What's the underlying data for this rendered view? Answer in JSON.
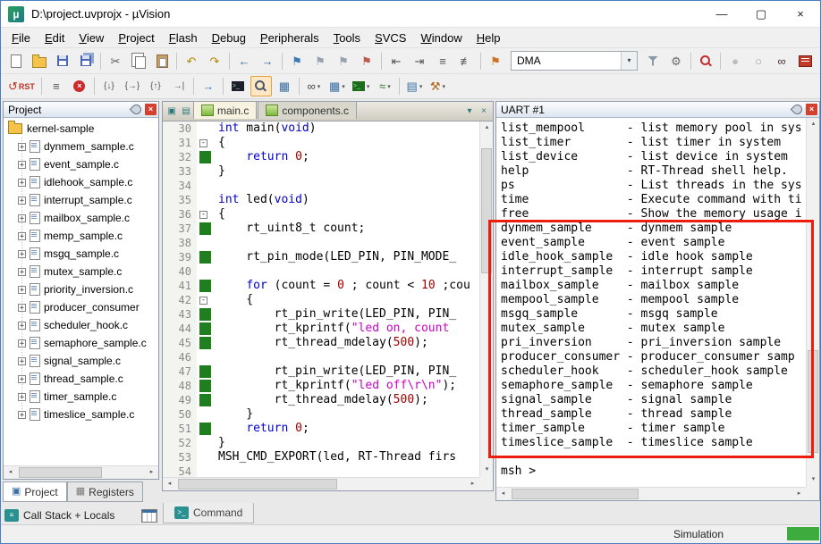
{
  "window": {
    "title": "D:\\project.uvprojx - µVision",
    "minimize_glyph": "—",
    "maximize_glyph": "▢",
    "close_glyph": "×"
  },
  "menu": {
    "items": [
      "File",
      "Edit",
      "View",
      "Project",
      "Flash",
      "Debug",
      "Peripherals",
      "Tools",
      "SVCS",
      "Window",
      "Help"
    ]
  },
  "toolbar1": {
    "target": "DMA",
    "left": [
      {
        "name": "new-file-icon",
        "cls": "ic-page"
      },
      {
        "name": "open-file-icon",
        "cls": "ic-folder"
      },
      {
        "name": "save-icon",
        "cls": "ic-floppy"
      },
      {
        "name": "save-all-icon",
        "cls": "ic-floppy saveall"
      },
      {
        "sep": true
      },
      {
        "name": "cut-icon",
        "glyph": "✂",
        "color": "#5a5a5a"
      },
      {
        "name": "copy-icon",
        "cls": "ic-copy"
      },
      {
        "name": "paste-icon",
        "cls": "ic-paste"
      },
      {
        "sep": true
      },
      {
        "name": "undo-icon",
        "glyph": "↶",
        "color": "#b08900"
      },
      {
        "name": "redo-icon",
        "glyph": "↷",
        "color": "#b08900"
      },
      {
        "sep": true
      },
      {
        "name": "navigate-back-icon",
        "glyph": "←",
        "color": "#2f66a0"
      },
      {
        "name": "navigate-forward-icon",
        "glyph": "→",
        "color": "#2f66a0"
      },
      {
        "sep": true
      },
      {
        "name": "toggle-bookmark-icon",
        "glyph": "⚑",
        "color": "#3b79b8"
      },
      {
        "name": "prev-bookmark-icon",
        "glyph": "⚑",
        "color": "#98a2ac"
      },
      {
        "name": "next-bookmark-icon",
        "glyph": "⚑",
        "color": "#98a2ac"
      },
      {
        "name": "clear-bookmarks-icon",
        "glyph": "⚑",
        "color": "#bf5a4a"
      },
      {
        "sep": true
      },
      {
        "name": "unindent-icon",
        "glyph": "⇤",
        "color": "#555555"
      },
      {
        "name": "indent-icon",
        "glyph": "⇥",
        "color": "#555555"
      },
      {
        "name": "comment-icon",
        "glyph": "≡",
        "color": "#555555"
      },
      {
        "name": "uncomment-icon",
        "glyph": "≢",
        "color": "#555555"
      },
      {
        "sep": true
      },
      {
        "name": "debug-target-icon",
        "glyph": "⚑",
        "color": "#d07020"
      }
    ],
    "right": [
      {
        "name": "options-for-target-icon",
        "cls": "ic-funnel"
      },
      {
        "name": "configure-flash-icon",
        "glyph": "⚙",
        "color": "#6a6a6a"
      },
      {
        "sep": true
      },
      {
        "name": "find-in-files-icon",
        "cls": "ic-magred"
      },
      {
        "sep": true
      },
      {
        "name": "start-stop-debug-icon",
        "glyph": "●",
        "color": "#bcbcbc"
      },
      {
        "name": "breakpoint-circle-icon",
        "glyph": "○",
        "color": "#9a9a9a"
      },
      {
        "name": "debug-views-icon",
        "glyph": "∞",
        "color": "#4a3030"
      },
      {
        "name": "books-icon",
        "cls": "ic-book"
      }
    ]
  },
  "toolbar2": {
    "items": [
      {
        "name": "reset-icon",
        "glyph": "↺",
        "color": "#c03020",
        "text": "RST"
      },
      {
        "sep": true
      },
      {
        "name": "breakpoint-list-icon",
        "glyph": "≡",
        "color": "#555555"
      },
      {
        "name": "kill-breakpoints-icon",
        "cls": "ic-stop"
      },
      {
        "sep": true
      },
      {
        "name": "step-into-icon",
        "glyph": "{↓}",
        "small": true,
        "color": "#555555"
      },
      {
        "name": "step-over-icon",
        "glyph": "{→}",
        "small": true,
        "color": "#555555"
      },
      {
        "name": "step-out-icon",
        "glyph": "{↑}",
        "small": true,
        "color": "#555555"
      },
      {
        "name": "run-to-cursor-icon",
        "glyph": "→|",
        "small": true,
        "color": "#555555"
      },
      {
        "sep": true
      },
      {
        "name": "go-icon",
        "glyph": "→",
        "color": "#3a7abf"
      },
      {
        "sep": true
      },
      {
        "name": "command-window-icon",
        "cls": "ic-console"
      },
      {
        "name": "serial-window-icon",
        "cls": "ic-mag",
        "active": true
      },
      {
        "name": "symbol-window-icon",
        "glyph": "▦",
        "color": "#3a6ea5"
      },
      {
        "sep": true
      },
      {
        "name": "watch-windows-icon",
        "glyph": "∞",
        "color": "#444444",
        "drop": true
      },
      {
        "name": "memory-windows-icon",
        "glyph": "▦",
        "color": "#3a6ea5",
        "drop": true
      },
      {
        "name": "serial-windows-icon",
        "cls": "ic-console green",
        "drop": true
      },
      {
        "name": "analysis-windows-icon",
        "glyph": "≈",
        "color": "#2a7a2a",
        "drop": true
      },
      {
        "sep": true
      },
      {
        "name": "system-viewer-icon",
        "glyph": "▤",
        "color": "#3a6ea5",
        "drop": true
      },
      {
        "name": "toolbox-icon",
        "glyph": "⚒",
        "color": "#b06820",
        "drop": true
      }
    ]
  },
  "project_panel": {
    "title": "Project",
    "root": "kernel-sample",
    "files": [
      "dynmem_sample.c",
      "event_sample.c",
      "idlehook_sample.c",
      "interrupt_sample.c",
      "mailbox_sample.c",
      "memp_sample.c",
      "msgq_sample.c",
      "mutex_sample.c",
      "priority_inversion.c",
      "producer_consumer",
      "scheduler_hook.c",
      "semaphore_sample.c",
      "signal_sample.c",
      "thread_sample.c",
      "timer_sample.c",
      "timeslice_sample.c"
    ],
    "tabs": [
      {
        "label": "Project",
        "icon": "▣",
        "icon_color": "#3a6ea5",
        "active": true
      },
      {
        "label": "Registers",
        "icon": "▦",
        "icon_color": "#777777",
        "active": false
      }
    ],
    "callstack_label": "Call Stack + Locals"
  },
  "bottom": {
    "command_tab": "Command"
  },
  "editor": {
    "tabs": [
      {
        "label": "main.c",
        "active": true
      },
      {
        "label": "components.c",
        "active": false
      }
    ],
    "lines": [
      {
        "n": 30,
        "t": [
          [
            "k",
            "int"
          ],
          [
            "p",
            " main("
          ],
          [
            "k",
            "void"
          ],
          [
            "p",
            ")"
          ]
        ]
      },
      {
        "n": 31,
        "f": true,
        "t": [
          [
            "p",
            "{"
          ]
        ]
      },
      {
        "n": 32,
        "g": true,
        "t": [
          [
            "p",
            "    "
          ],
          [
            "k",
            "return"
          ],
          [
            "p",
            " "
          ],
          [
            "n",
            "0"
          ],
          [
            "p",
            ";"
          ]
        ]
      },
      {
        "n": 33,
        "t": [
          [
            "p",
            "}"
          ]
        ]
      },
      {
        "n": 34,
        "t": []
      },
      {
        "n": 35,
        "t": [
          [
            "k",
            "int"
          ],
          [
            "p",
            " led("
          ],
          [
            "k",
            "void"
          ],
          [
            "p",
            ")"
          ]
        ]
      },
      {
        "n": 36,
        "f": true,
        "t": [
          [
            "p",
            "{"
          ]
        ]
      },
      {
        "n": 37,
        "g": true,
        "t": [
          [
            "p",
            "    rt_uint8_t count;"
          ]
        ]
      },
      {
        "n": 38,
        "t": []
      },
      {
        "n": 39,
        "g": true,
        "t": [
          [
            "p",
            "    rt_pin_mode(LED_PIN, PIN_MODE_"
          ]
        ]
      },
      {
        "n": 40,
        "t": []
      },
      {
        "n": 41,
        "g": true,
        "t": [
          [
            "p",
            "    "
          ],
          [
            "k",
            "for"
          ],
          [
            "p",
            " (count = "
          ],
          [
            "n",
            "0"
          ],
          [
            "p",
            " ; count < "
          ],
          [
            "n",
            "10"
          ],
          [
            "p",
            " ;cou"
          ]
        ]
      },
      {
        "n": 42,
        "f": true,
        "t": [
          [
            "p",
            "    {"
          ]
        ]
      },
      {
        "n": 43,
        "g": true,
        "t": [
          [
            "p",
            "        rt_pin_write(LED_PIN, PIN_"
          ]
        ]
      },
      {
        "n": 44,
        "g": true,
        "t": [
          [
            "p",
            "        rt_kprintf("
          ],
          [
            "s",
            "\"led on, count"
          ]
        ]
      },
      {
        "n": 45,
        "g": true,
        "t": [
          [
            "p",
            "        rt_thread_mdelay("
          ],
          [
            "n",
            "500"
          ],
          [
            "p",
            ");"
          ]
        ]
      },
      {
        "n": 46,
        "t": []
      },
      {
        "n": 47,
        "g": true,
        "t": [
          [
            "p",
            "        rt_pin_write(LED_PIN, PIN_"
          ]
        ]
      },
      {
        "n": 48,
        "g": true,
        "t": [
          [
            "p",
            "        rt_kprintf("
          ],
          [
            "s",
            "\"led off\\r\\n\""
          ],
          [
            "p",
            ");"
          ]
        ]
      },
      {
        "n": 49,
        "g": true,
        "t": [
          [
            "p",
            "        rt_thread_mdelay("
          ],
          [
            "n",
            "500"
          ],
          [
            "p",
            ");"
          ]
        ]
      },
      {
        "n": 50,
        "t": [
          [
            "p",
            "    }"
          ]
        ]
      },
      {
        "n": 51,
        "g": true,
        "t": [
          [
            "p",
            "    "
          ],
          [
            "k",
            "return"
          ],
          [
            "p",
            " "
          ],
          [
            "n",
            "0"
          ],
          [
            "p",
            ";"
          ]
        ]
      },
      {
        "n": 52,
        "t": [
          [
            "p",
            "}"
          ]
        ]
      },
      {
        "n": 53,
        "t": [
          [
            "p",
            "MSH_CMD_EXPORT(led, RT-Thread firs"
          ]
        ]
      },
      {
        "n": 54,
        "t": []
      }
    ]
  },
  "uart": {
    "title": "UART #1",
    "prompt": "msh >",
    "lines": [
      {
        "c": "list_mempool",
        "d": "- list memory pool in sys"
      },
      {
        "c": "list_timer",
        "d": "- list timer in system"
      },
      {
        "c": "list_device",
        "d": "- list device in system"
      },
      {
        "c": "help",
        "d": "- RT-Thread shell help."
      },
      {
        "c": "ps",
        "d": "- List threads in the sys"
      },
      {
        "c": "time",
        "d": "- Execute command with ti"
      },
      {
        "c": "free",
        "d": "- Show the memory usage i"
      },
      {
        "c": "dynmem_sample",
        "d": "- dynmem sample"
      },
      {
        "c": "event_sample",
        "d": "- event sample"
      },
      {
        "c": "idle_hook_sample",
        "d": "- idle hook sample"
      },
      {
        "c": "interrupt_sample",
        "d": "- interrupt sample"
      },
      {
        "c": "mailbox_sample",
        "d": "- mailbox sample"
      },
      {
        "c": "mempool_sample",
        "d": "- mempool sample"
      },
      {
        "c": "msgq_sample",
        "d": "- msgq sample"
      },
      {
        "c": "mutex_sample",
        "d": "- mutex sample"
      },
      {
        "c": "pri_inversion",
        "d": "- pri_inversion sample"
      },
      {
        "c": "producer_consumer",
        "d": "- producer_consumer samp"
      },
      {
        "c": "scheduler_hook",
        "d": "- scheduler_hook sample"
      },
      {
        "c": "semaphore_sample",
        "d": "- semaphore sample"
      },
      {
        "c": "signal_sample",
        "d": "- signal sample"
      },
      {
        "c": "thread_sample",
        "d": "- thread sample"
      },
      {
        "c": "timer_sample",
        "d": "- timer sample"
      },
      {
        "c": "timeslice_sample",
        "d": "- timeslice sample"
      },
      {
        "c": "",
        "d": ""
      }
    ]
  },
  "statusbar": {
    "mode": "Simulation"
  }
}
